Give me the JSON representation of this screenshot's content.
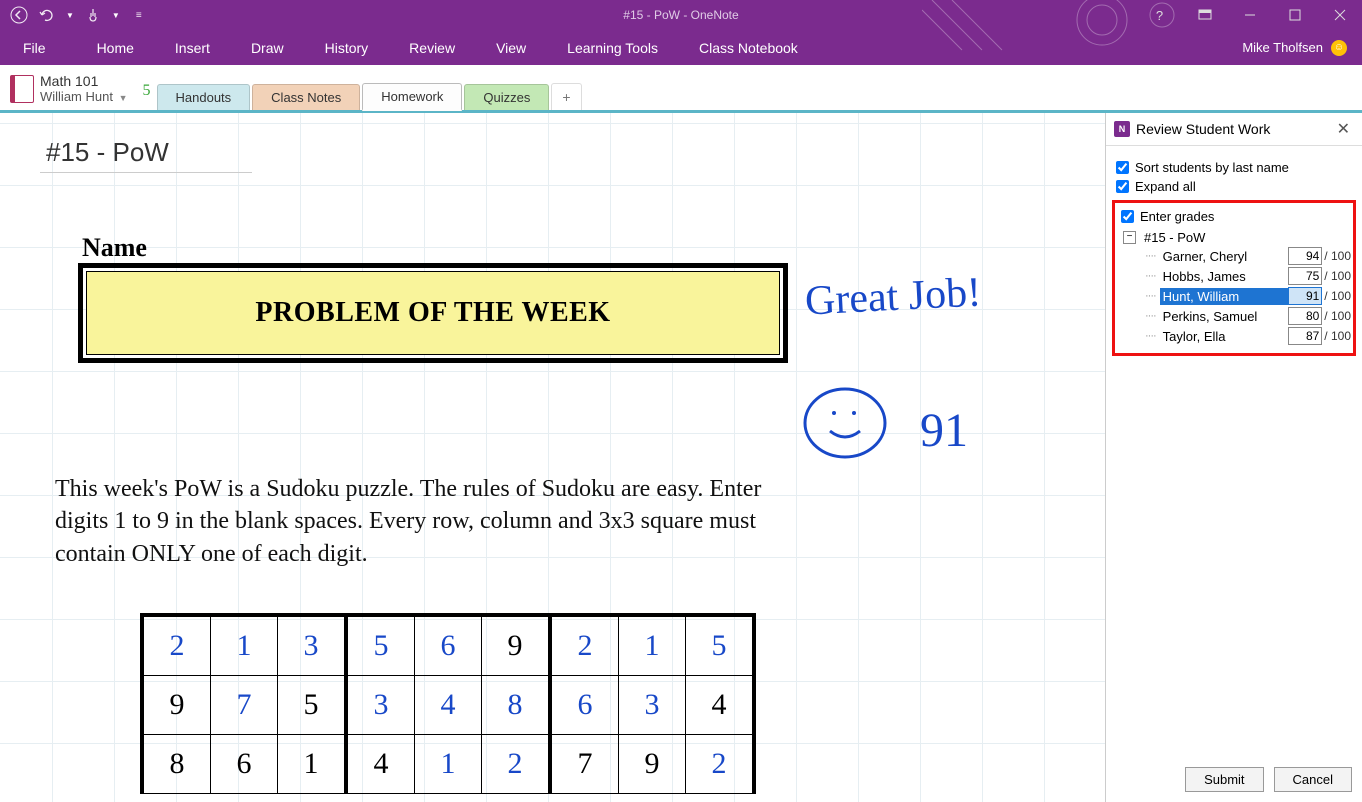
{
  "window": {
    "title": "#15 - PoW - OneNote",
    "user": "Mike Tholfsen"
  },
  "ribbon": {
    "file": "File",
    "tabs": [
      "Home",
      "Insert",
      "Draw",
      "History",
      "Review",
      "View",
      "Learning Tools",
      "Class Notebook"
    ]
  },
  "notebook": {
    "title": "Math 101",
    "student": "William Hunt",
    "pending_pages": "5"
  },
  "section_tabs": [
    {
      "label": "Handouts",
      "cls": "handouts"
    },
    {
      "label": "Class Notes",
      "cls": "classnotes"
    },
    {
      "label": "Homework",
      "cls": "homework"
    },
    {
      "label": "Quizzes",
      "cls": "quizzes"
    }
  ],
  "add_tab": "+",
  "page": {
    "title": "#15 - PoW",
    "name_label": "Name",
    "pow_heading": "PROBLEM OF THE WEEK",
    "instructions": "This week's PoW is a Sudoku puzzle. The rules of Sudoku are easy. Enter digits 1 to 9 in the blank spaces. Every row, column and 3x3 square must contain ONLY one of each digit.",
    "ink_great": "Great Job!",
    "ink_score": "91"
  },
  "sudoku": {
    "rows": [
      [
        {
          "v": "2",
          "hand": true
        },
        {
          "v": "1",
          "hand": true
        },
        {
          "v": "3",
          "hand": true
        },
        {
          "v": "5",
          "hand": true
        },
        {
          "v": "6",
          "hand": true
        },
        {
          "v": "9",
          "hand": false
        },
        {
          "v": "2",
          "hand": true
        },
        {
          "v": "1",
          "hand": true
        },
        {
          "v": "5",
          "hand": true
        }
      ],
      [
        {
          "v": "9",
          "hand": false
        },
        {
          "v": "7",
          "hand": true
        },
        {
          "v": "5",
          "hand": false
        },
        {
          "v": "3",
          "hand": true
        },
        {
          "v": "4",
          "hand": true
        },
        {
          "v": "8",
          "hand": true
        },
        {
          "v": "6",
          "hand": true
        },
        {
          "v": "3",
          "hand": true
        },
        {
          "v": "4",
          "hand": false
        }
      ],
      [
        {
          "v": "8",
          "hand": false
        },
        {
          "v": "6",
          "hand": false
        },
        {
          "v": "1",
          "hand": false
        },
        {
          "v": "4",
          "hand": false
        },
        {
          "v": "1",
          "hand": true
        },
        {
          "v": "2",
          "hand": true
        },
        {
          "v": "7",
          "hand": false
        },
        {
          "v": "9",
          "hand": false
        },
        {
          "v": "2",
          "hand": true
        }
      ]
    ]
  },
  "panel": {
    "title": "Review Student Work",
    "sort_label": "Sort students by last name",
    "expand_label": "Expand all",
    "grades_label": "Enter grades",
    "assignment": "#15 - PoW",
    "students": [
      {
        "name": "Garner, Cheryl",
        "grade": "94",
        "max": "100",
        "selected": false
      },
      {
        "name": "Hobbs, James",
        "grade": "75",
        "max": "100",
        "selected": false
      },
      {
        "name": "Hunt, William",
        "grade": "91",
        "max": "100",
        "selected": true
      },
      {
        "name": "Perkins, Samuel",
        "grade": "80",
        "max": "100",
        "selected": false
      },
      {
        "name": "Taylor, Ella",
        "grade": "87",
        "max": "100",
        "selected": false
      }
    ],
    "submit": "Submit",
    "cancel": "Cancel"
  }
}
